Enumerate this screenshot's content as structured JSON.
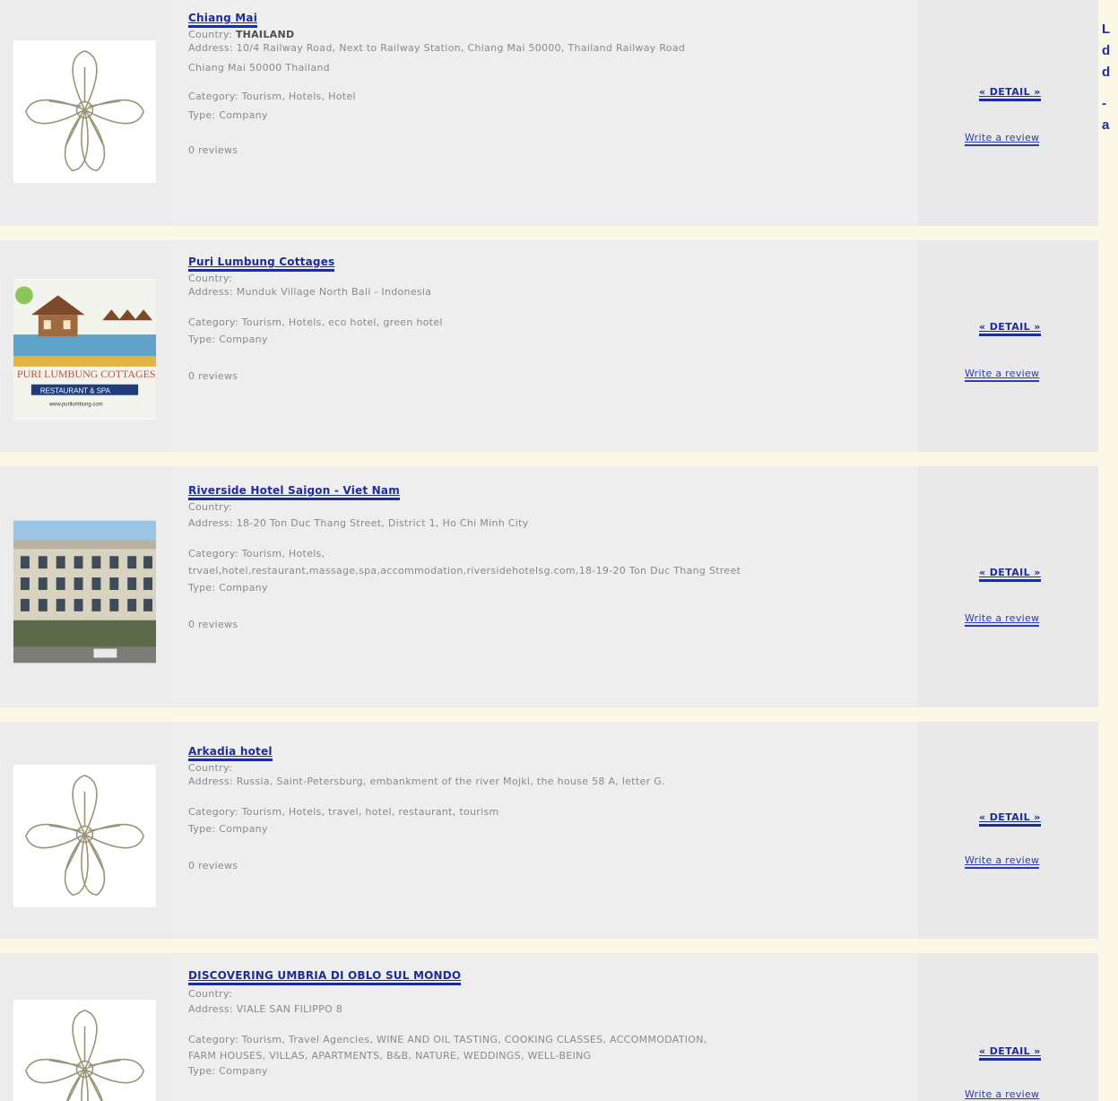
{
  "listings": [
    {
      "name": "Chiang Mai",
      "country_label": "Country:",
      "country": "THAILAND",
      "address": "Address: 10/4 Railway Road, Next to Railway Station, Chiang Mai 50000, Thailand Railway Road",
      "address2": " Chiang Mai   50000  Thailand",
      "category": "Category: Tourism, Hotels, Hotel",
      "category2": "",
      "type": "Type: Company",
      "reviews": "0  reviews",
      "detail": "« DETAIL »",
      "review_link": "Write a review",
      "image_icon": "flower-logo-icon"
    },
    {
      "name": "Puri Lumbung Cottages",
      "country_label": "Country:",
      "country": "",
      "address": "Address: Munduk Village North Bali - Indonesia",
      "address2": "",
      "category": "Category: Tourism, Hotels, eco hotel, green hotel",
      "category2": "",
      "type": "Type: Company",
      "reviews": "0  reviews",
      "detail": "« DETAIL »",
      "review_link": "Write a review",
      "image_icon": "cottage-logo-icon"
    },
    {
      "name": "Riverside Hotel Saigon - Viet Nam",
      "country_label": "Country:",
      "country": "",
      "address": "Address: 18-20 Ton Duc Thang Street, District 1, Ho Chi Minh City",
      "address2": "",
      "category": "Category: Tourism, Hotels,",
      "category2": "trvael,hotel,restaurant,massage,spa,accommodation,riversidehotelsg.com,18-19-20 Ton Duc Thang Street",
      "type": "Type: Company",
      "reviews": "0  reviews",
      "detail": "« DETAIL »",
      "review_link": "Write a review",
      "image_icon": "hotel-building-photo"
    },
    {
      "name": "Arkadia hotel",
      "country_label": "Country:",
      "country": "",
      "address": "Address: Russia, Saint-Petersburg, embankment of the river Mojki, the house 58 A, letter G.",
      "address2": "",
      "category": "Category: Tourism, Hotels, travel, hotel, restaurant, tourism",
      "category2": "",
      "type": "Type: Company",
      "reviews": "0  reviews",
      "detail": "« DETAIL »",
      "review_link": "Write a review",
      "image_icon": "flower-logo-icon"
    },
    {
      "name": "DISCOVERING UMBRIA DI OBLO SUL MONDO",
      "country_label": "Country:",
      "country": "",
      "address": "Address: VIALE SAN FILIPPO 8",
      "address2": "",
      "category": "Category: Tourism, Travel Agencies, WINE AND OIL TASTING, COOKING CLASSES, ACCOMMODATION,",
      "category2": "FARM HOUSES, VILLAS, APARTMENTS, B&B, NATURE, WEDDINGS, WELL-BEING",
      "type": "Type: Company",
      "reviews": "",
      "detail": "« DETAIL »",
      "review_link": "Write a review",
      "image_icon": "flower-logo-icon"
    }
  ],
  "side_panel": {
    "line1": "L",
    "line2": "d",
    "line3": "d",
    "line4": "-",
    "line5": "a"
  }
}
